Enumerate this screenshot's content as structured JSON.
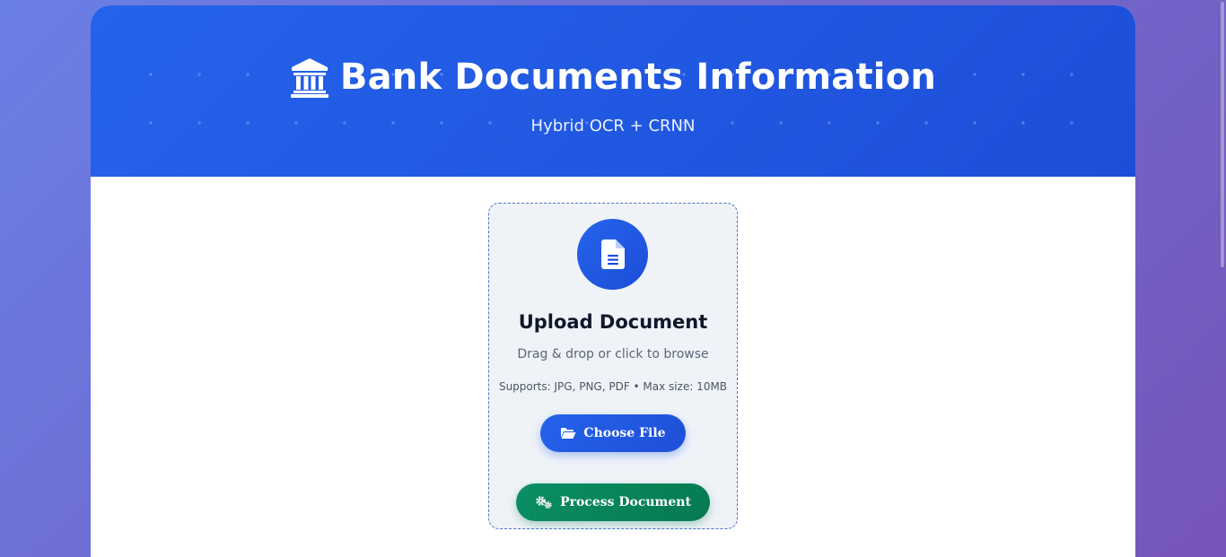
{
  "header": {
    "title": "Bank Documents Information",
    "subtitle": "Hybrid OCR + CRNN",
    "icon": "bank-icon"
  },
  "upload": {
    "icon": "document-icon",
    "title": "Upload Document",
    "hint": "Drag & drop or click to browse",
    "supports": "Supports: JPG, PNG, PDF • Max size: 10MB",
    "choose_button": {
      "label": "Choose File",
      "icon": "folder-open-icon"
    },
    "process_button": {
      "label": "Process Document",
      "icon": "gears-icon"
    }
  },
  "colors": {
    "header_blue": "#2563eb",
    "process_green": "#05794f",
    "page_bg_start": "#6a7fe6",
    "page_bg_end": "#7655b8"
  }
}
